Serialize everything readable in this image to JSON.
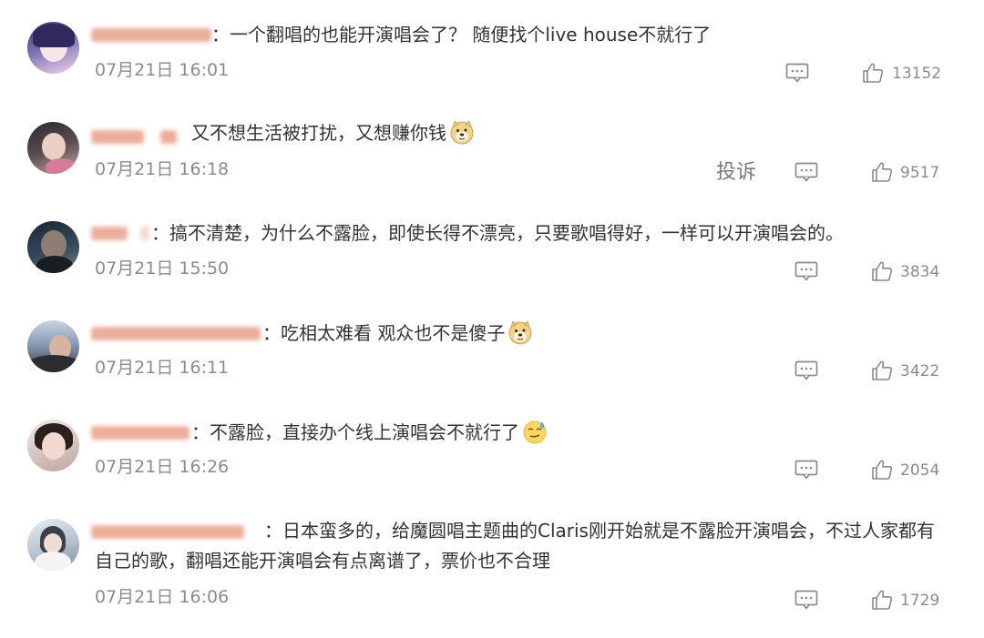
{
  "comments": [
    {
      "separator": "：",
      "text": "一个翻唱的也能开演唱会了？ 随便找个live house不就行了",
      "time": "07月21日 16:01",
      "likes": "13152",
      "emoji": ""
    },
    {
      "separator": "",
      "text": "又不想生活被打扰，又想赚你钱",
      "time": "07月21日 16:18",
      "likes": "9517",
      "emoji": "doge",
      "report_label": "投诉"
    },
    {
      "separator": "：",
      "text": "搞不清楚，为什么不露脸，即使长得不漂亮，只要歌唱得好，一样可以开演唱会的。",
      "time": "07月21日 15:50",
      "likes": "3834",
      "emoji": ""
    },
    {
      "separator": "：",
      "text": "吃相太难看 观众也不是傻子",
      "time": "07月21日 16:11",
      "likes": "3422",
      "emoji": "doge"
    },
    {
      "separator": "：",
      "text": "不露脸，直接办个线上演唱会不就行了",
      "time": "07月21日 16:26",
      "likes": "2054",
      "emoji": "sweat-smile"
    },
    {
      "separator": "：",
      "text": "日本蛮多的，给魔圆唱主题曲的Claris刚开始就是不露脸开演唱会，不过人家都有自己的歌，翻唱还能开演唱会有点离谱了，票价也不合理",
      "time": "07月21日 16:06",
      "likes": "1729",
      "emoji": ""
    }
  ],
  "colors": {
    "text": "#333333",
    "meta": "#8b8b8b",
    "icon": "#8a8a8a",
    "blur_name": "#e9a08a"
  }
}
